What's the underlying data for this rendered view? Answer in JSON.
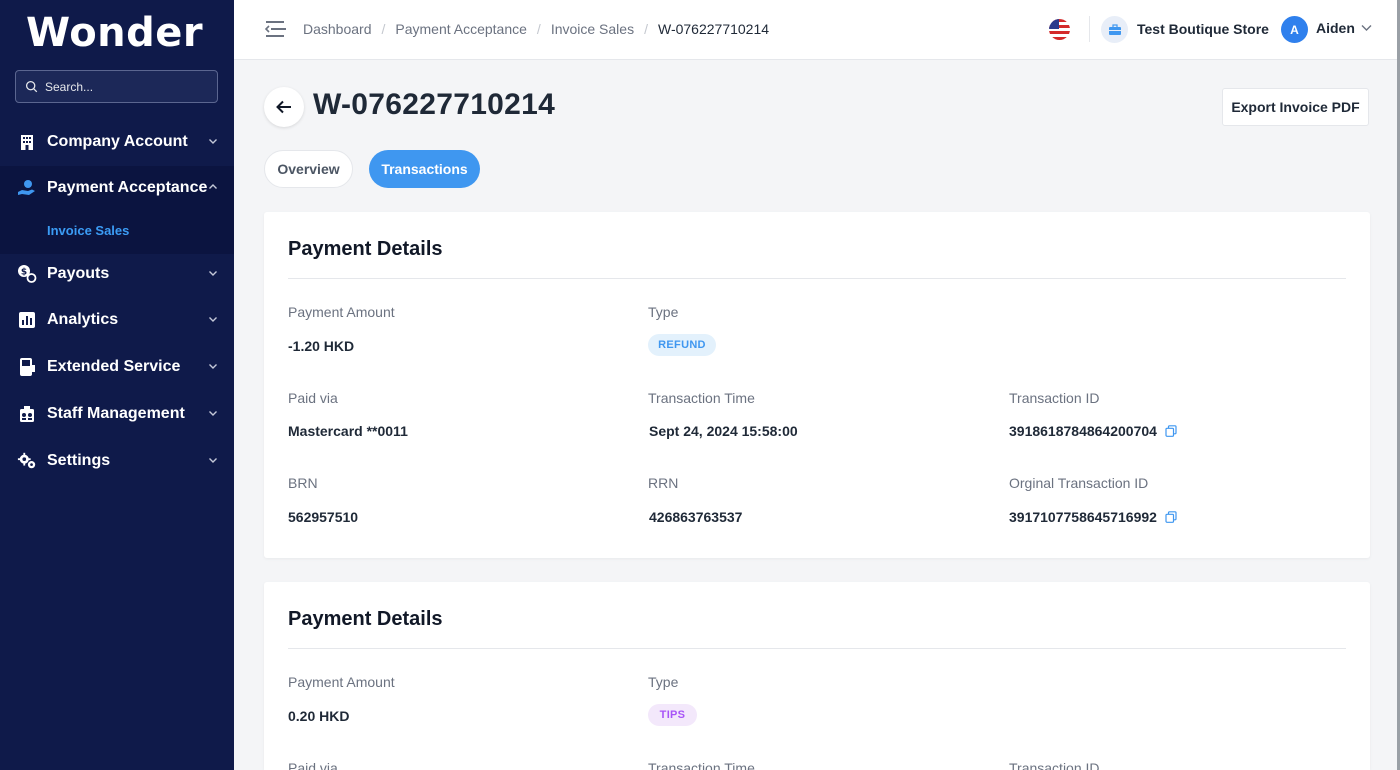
{
  "sidebar": {
    "logo": "Wonder",
    "search_placeholder": "Search...",
    "items": [
      {
        "label": "Company Account"
      },
      {
        "label": "Payment Acceptance"
      },
      {
        "label": "Payouts"
      },
      {
        "label": "Analytics"
      },
      {
        "label": "Extended Service"
      },
      {
        "label": "Staff Management"
      },
      {
        "label": "Settings"
      }
    ],
    "active_subitem": "Invoice Sales"
  },
  "header": {
    "breadcrumbs": [
      "Dashboard",
      "Payment Acceptance",
      "Invoice Sales",
      "W-076227710214"
    ],
    "store_name": "Test Boutique Store",
    "avatar_initial": "A",
    "user_name": "Aiden"
  },
  "page": {
    "title": "W-076227710214",
    "export_label": "Export Invoice PDF",
    "tabs": [
      {
        "label": "Overview",
        "active": false
      },
      {
        "label": "Transactions",
        "active": true
      }
    ]
  },
  "cards": [
    {
      "title": "Payment Details",
      "payment_amount_label": "Payment Amount",
      "payment_amount": "-1.20 HKD",
      "type_label": "Type",
      "type": "REFUND",
      "paid_via_label": "Paid via",
      "paid_via": "Mastercard **0011",
      "transaction_time_label": "Transaction Time",
      "transaction_time": "Sept 24, 2024 15:58:00",
      "transaction_id_label": "Transaction ID",
      "transaction_id": "3918618784864200704",
      "brn_label": "BRN",
      "brn": "562957510",
      "rrn_label": "RRN",
      "rrn": "426863763537",
      "original_transaction_id_label": "Orginal Transaction ID",
      "original_transaction_id": "3917107758645716992"
    },
    {
      "title": "Payment Details",
      "payment_amount_label": "Payment Amount",
      "payment_amount": "0.20 HKD",
      "type_label": "Type",
      "type": "TIPS",
      "paid_via_label": "Paid via",
      "transaction_time_label": "Transaction Time",
      "transaction_id_label": "Transaction ID"
    }
  ],
  "colors": {
    "sidebar_bg": "#0f1a4a",
    "accent": "#3f97f0",
    "refund_badge": "#e3f1fc",
    "tips_badge": "#f3e8fb"
  }
}
